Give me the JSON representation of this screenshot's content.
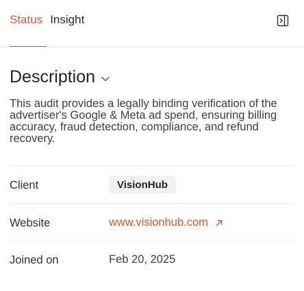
{
  "tabs": [
    {
      "label": "Status",
      "active": true
    },
    {
      "label": "Insight",
      "active": false
    }
  ],
  "icons": {
    "panel_toggle": "sidebar-panel-icon",
    "section_chevron": "chevron-down-icon",
    "external_link": "arrow-up-right-icon"
  },
  "colors": {
    "accent": "#d9562e",
    "text": "#1f2328",
    "muted_text": "#3a3f45",
    "badge_bg": "#f1f1f1",
    "divider": "#ececec"
  },
  "section": {
    "title": "Description",
    "description": "This audit provides a legally binding verification of the advertiser's Google & Meta ad spend, ensuring billing accuracy, fraud detection, compliance, and refund recovery."
  },
  "details": {
    "client_label": "Client",
    "client_value": "VisionHub",
    "website_label": "Website",
    "website_value": "www.visionhub.com",
    "joined_label": "Joined on",
    "joined_value": "Feb 20, 2025"
  }
}
